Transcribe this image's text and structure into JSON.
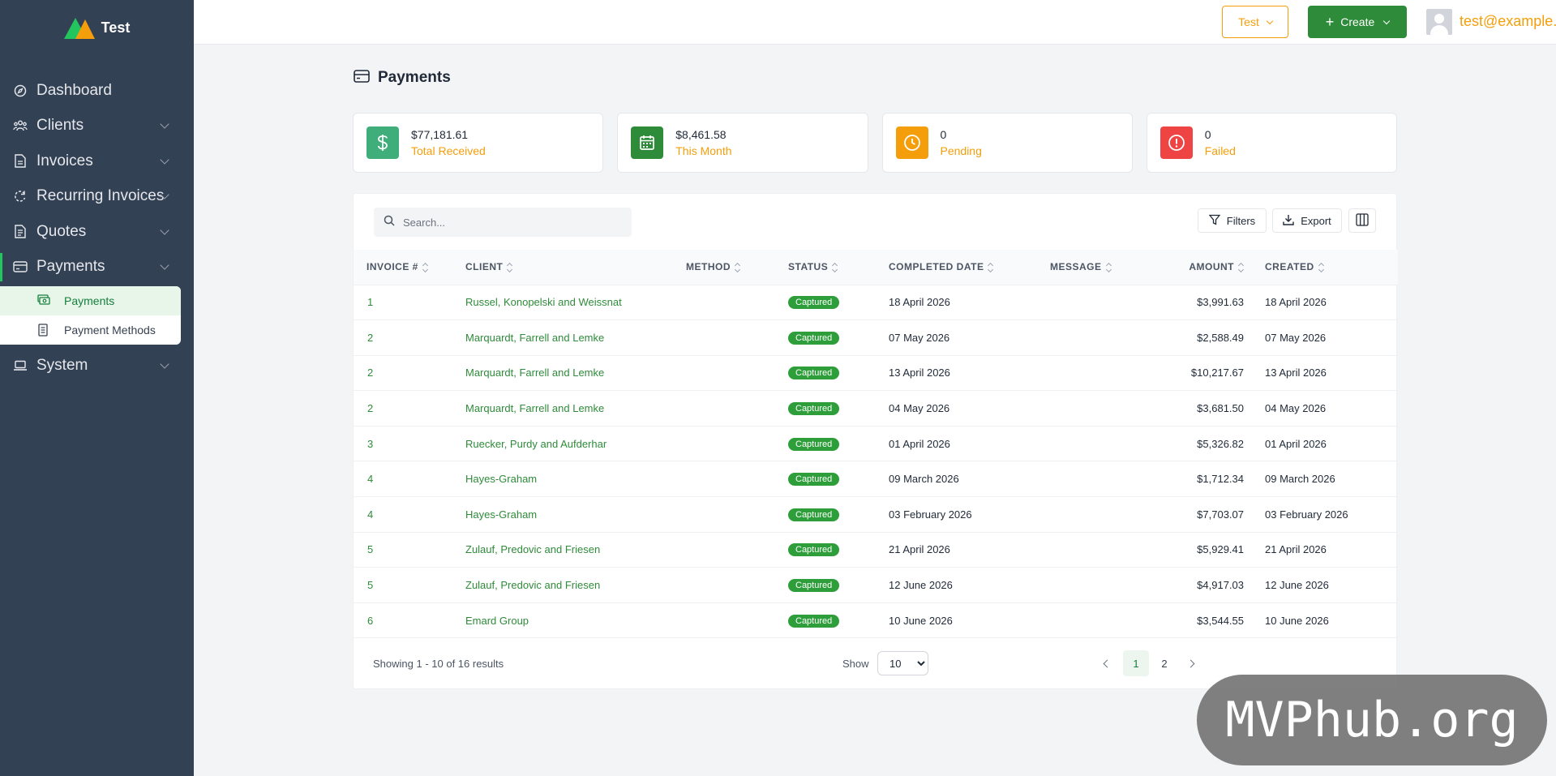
{
  "app": {
    "name": "Test"
  },
  "sidebar": {
    "items": [
      {
        "label": "Dashboard",
        "icon": "dashboard-icon"
      },
      {
        "label": "Clients",
        "icon": "users-icon"
      },
      {
        "label": "Invoices",
        "icon": "invoice-icon"
      },
      {
        "label": "Recurring Invoices",
        "icon": "recurring-icon"
      },
      {
        "label": "Quotes",
        "icon": "quote-icon"
      },
      {
        "label": "Payments",
        "icon": "payments-icon"
      },
      {
        "label": "System",
        "icon": "laptop-icon"
      }
    ],
    "payments_sub": [
      {
        "label": "Payments",
        "icon": "cash-icon"
      },
      {
        "label": "Payment Methods",
        "icon": "receipt-icon"
      }
    ]
  },
  "header": {
    "company_button": "Test",
    "create_button": "Create",
    "user_email": "test@example.com"
  },
  "page": {
    "title": "Payments"
  },
  "stats": [
    {
      "value": "$77,181.61",
      "label": "Total Received",
      "color": "#3fae7a",
      "icon": "dollar-icon"
    },
    {
      "value": "$8,461.58",
      "label": "This Month",
      "color": "#2e8b3a",
      "icon": "calendar-icon"
    },
    {
      "value": "0",
      "label": "Pending",
      "color": "#f59e0b",
      "icon": "clock-icon"
    },
    {
      "value": "0",
      "label": "Failed",
      "color": "#ef4444",
      "icon": "alert-icon"
    }
  ],
  "toolbar": {
    "search_placeholder": "Search...",
    "filters_label": "Filters",
    "export_label": "Export"
  },
  "table": {
    "columns": [
      "Invoice #",
      "Client",
      "Method",
      "Status",
      "Completed Date",
      "Message",
      "Amount",
      "Created"
    ],
    "rows": [
      {
        "invoice": "1",
        "client": "Russel, Konopelski and Weissnat",
        "method": "",
        "status": "Captured",
        "completed": "18 April 2026",
        "message": "",
        "amount": "$3,991.63",
        "created": "18 April 2026"
      },
      {
        "invoice": "2",
        "client": "Marquardt, Farrell and Lemke",
        "method": "",
        "status": "Captured",
        "completed": "07 May 2026",
        "message": "",
        "amount": "$2,588.49",
        "created": "07 May 2026"
      },
      {
        "invoice": "2",
        "client": "Marquardt, Farrell and Lemke",
        "method": "",
        "status": "Captured",
        "completed": "13 April 2026",
        "message": "",
        "amount": "$10,217.67",
        "created": "13 April 2026"
      },
      {
        "invoice": "2",
        "client": "Marquardt, Farrell and Lemke",
        "method": "",
        "status": "Captured",
        "completed": "04 May 2026",
        "message": "",
        "amount": "$3,681.50",
        "created": "04 May 2026"
      },
      {
        "invoice": "3",
        "client": "Ruecker, Purdy and Aufderhar",
        "method": "",
        "status": "Captured",
        "completed": "01 April 2026",
        "message": "",
        "amount": "$5,326.82",
        "created": "01 April 2026"
      },
      {
        "invoice": "4",
        "client": "Hayes-Graham",
        "method": "",
        "status": "Captured",
        "completed": "09 March 2026",
        "message": "",
        "amount": "$1,712.34",
        "created": "09 March 2026"
      },
      {
        "invoice": "4",
        "client": "Hayes-Graham",
        "method": "",
        "status": "Captured",
        "completed": "03 February 2026",
        "message": "",
        "amount": "$7,703.07",
        "created": "03 February 2026"
      },
      {
        "invoice": "5",
        "client": "Zulauf, Predovic and Friesen",
        "method": "",
        "status": "Captured",
        "completed": "21 April 2026",
        "message": "",
        "amount": "$5,929.41",
        "created": "21 April 2026"
      },
      {
        "invoice": "5",
        "client": "Zulauf, Predovic and Friesen",
        "method": "",
        "status": "Captured",
        "completed": "12 June 2026",
        "message": "",
        "amount": "$4,917.03",
        "created": "12 June 2026"
      },
      {
        "invoice": "6",
        "client": "Emard Group",
        "method": "",
        "status": "Captured",
        "completed": "10 June 2026",
        "message": "",
        "amount": "$3,544.55",
        "created": "10 June 2026"
      }
    ]
  },
  "footer": {
    "showing": "Showing 1 - 10 of 16 results",
    "show_label": "Show",
    "page_size": "10",
    "pages": [
      "1",
      "2"
    ],
    "current_page": "1"
  },
  "watermark": "MVPhub.org"
}
